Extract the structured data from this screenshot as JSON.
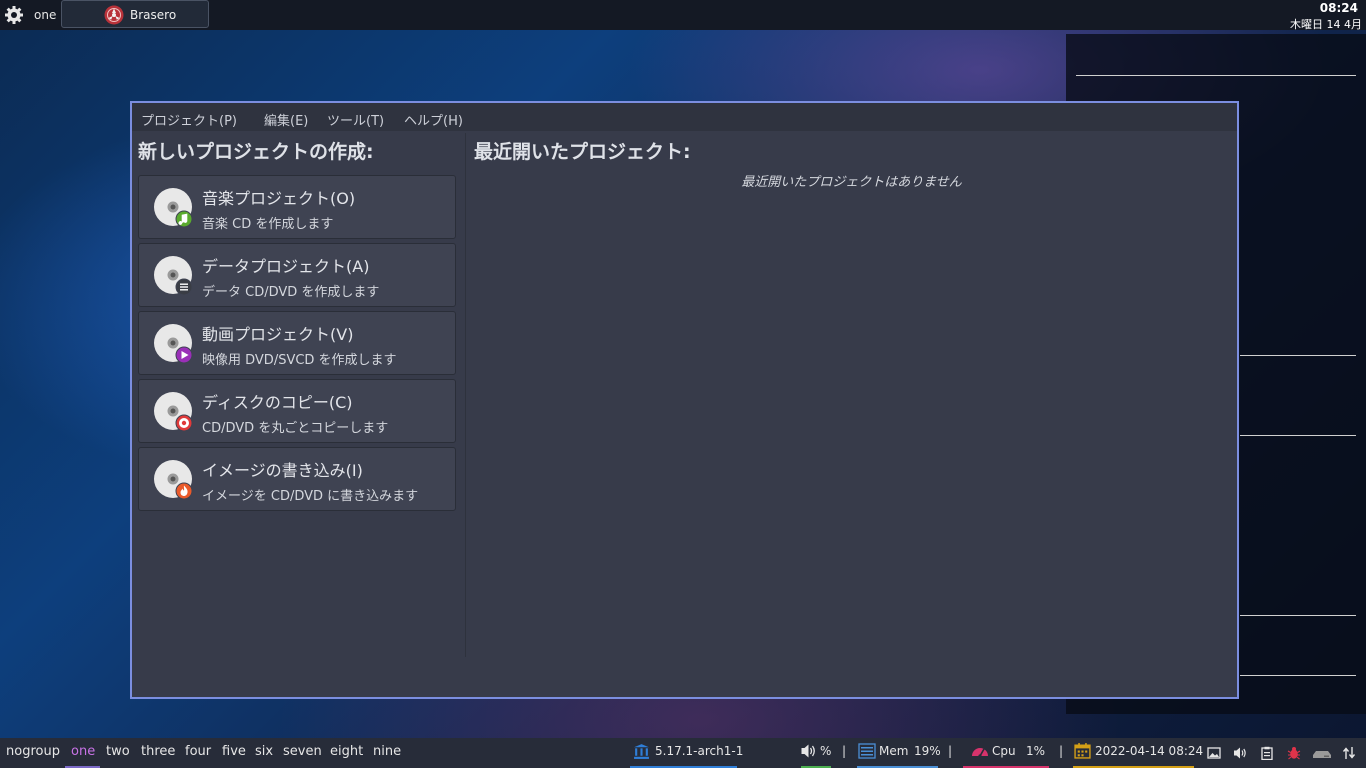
{
  "topbar": {
    "workspace": "one",
    "task_title": "Brasero",
    "clock_time": "08:24",
    "clock_date": "木曜日 14 4月"
  },
  "window": {
    "menu": [
      "プロジェクト(P)",
      "編集(E)",
      "ツール(T)",
      "ヘルプ(H)"
    ],
    "left_title": "新しいプロジェクトの作成:",
    "right_title": "最近開いたプロジェクト:",
    "no_recent": "最近開いたプロジェクトはありません",
    "projects": [
      {
        "title": "音楽プロジェクト(O)",
        "desc": "音楽 CD を作成します",
        "badge": "music-note-icon",
        "badge_color": "#5aaa2e"
      },
      {
        "title": "データプロジェクト(A)",
        "desc": "データ CD/DVD を作成します",
        "badge": "list-icon",
        "badge_color": "#3a3d45"
      },
      {
        "title": "動画プロジェクト(V)",
        "desc": "映像用 DVD/SVCD を作成します",
        "badge": "play-icon",
        "badge_color": "#9a2fb8"
      },
      {
        "title": "ディスクのコピー(C)",
        "desc": "CD/DVD を丸ごとコピーします",
        "badge": "record-icon",
        "badge_color": "#e03a3a"
      },
      {
        "title": "イメージの書き込み(I)",
        "desc": "イメージを CD/DVD に書き込みます",
        "badge": "flame-icon",
        "badge_color": "#ea5a2a"
      }
    ]
  },
  "bottombar": {
    "workspaces": [
      "nogroup",
      "one",
      "two",
      "three",
      "four",
      "five",
      "six",
      "seven",
      "eight",
      "nine"
    ],
    "active_workspace": "one",
    "kernel": "5.17.1-arch1-1",
    "volume": "%",
    "mem_label": "Mem",
    "mem_value": "19%",
    "cpu_label": "Cpu",
    "cpu_value": "1%",
    "datetime": "2022-04-14 08:24",
    "separator": "|",
    "colors": {
      "kernel": "#2f7ed8",
      "volume": "#4caf50",
      "mem": "#4a8fd6",
      "cpu": "#d6336c",
      "date": "#d4a017",
      "active_ws": "#c873e6"
    }
  }
}
